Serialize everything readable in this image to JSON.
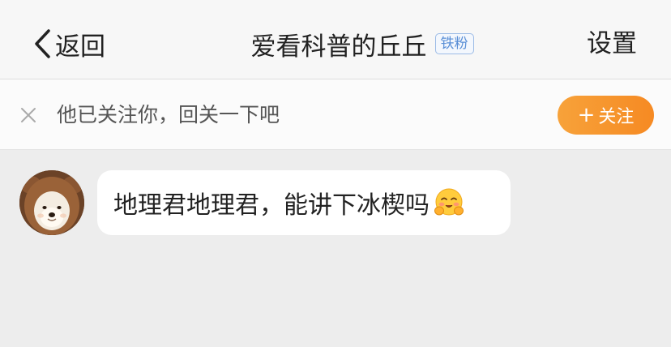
{
  "header": {
    "back_label": "返回",
    "title": "爱看科普的丘丘",
    "badge": "铁粉",
    "settings_label": "设置"
  },
  "banner": {
    "text": "他已关注你，回关一下吧",
    "follow_plus": "+",
    "follow_label": "关注"
  },
  "message": {
    "text": "地理君地理君，能讲下冰楔吗",
    "emoji": "blushing-hug-emoji"
  },
  "colors": {
    "follow_button": "#f68a23",
    "badge": "#5a8fd6",
    "background": "#ededed"
  }
}
